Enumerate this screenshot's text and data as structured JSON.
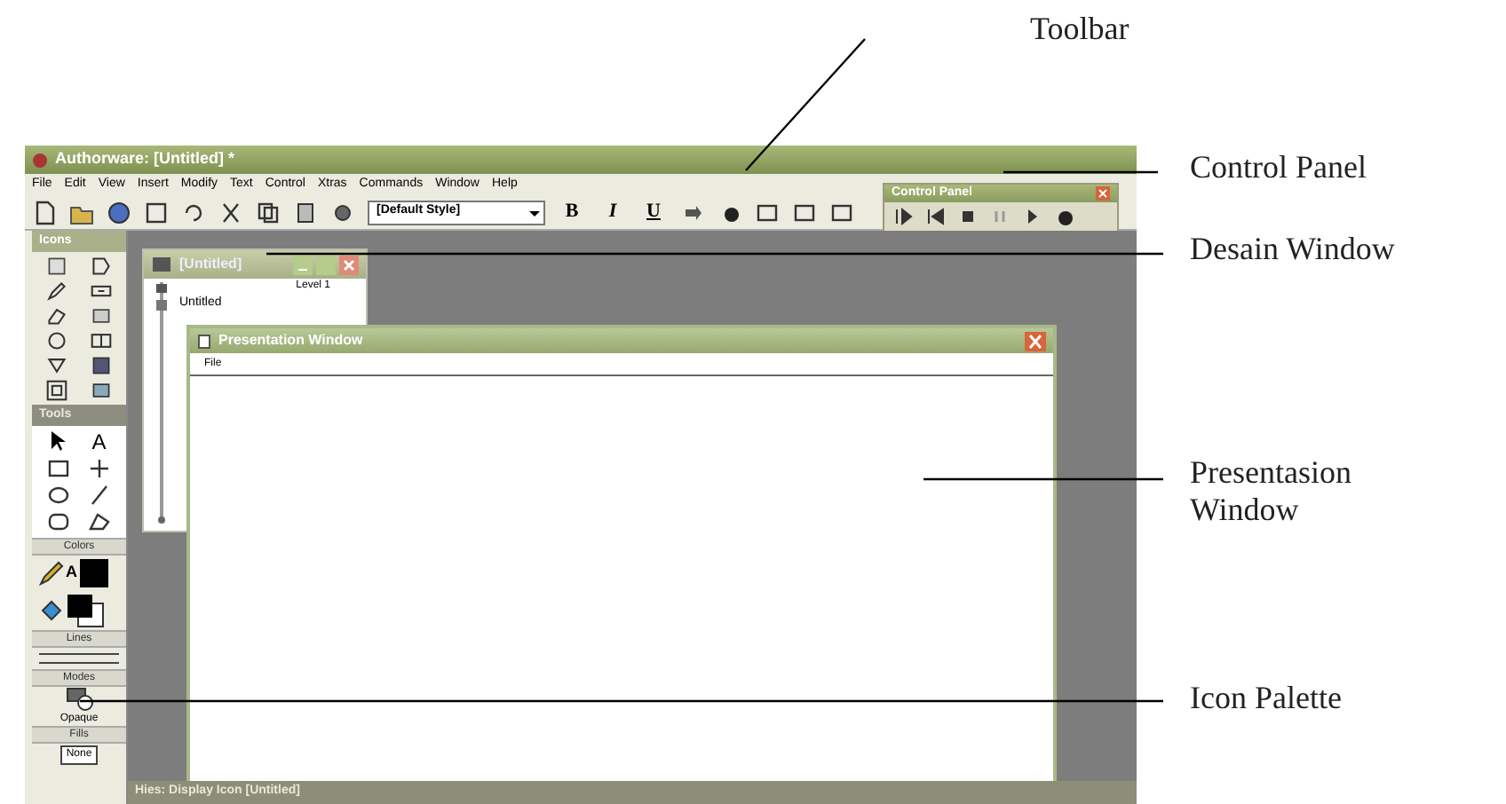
{
  "window": {
    "title": "Authorware: [Untitled] *"
  },
  "menu": [
    "File",
    "Edit",
    "View",
    "Insert",
    "Modify",
    "Text",
    "Control",
    "Xtras",
    "Commands",
    "Window",
    "Help"
  ],
  "toolbar": {
    "style_dropdown": "[Default Style]",
    "format_buttons": [
      "B",
      "I",
      "U"
    ]
  },
  "control_panel": {
    "title": "Control Panel"
  },
  "palette": {
    "icons_title": "Icons",
    "tools_title": "Tools",
    "text_tool": "A",
    "colors_title": "Colors",
    "colors_text": "A",
    "lines_title": "Lines",
    "modes_title": "Modes",
    "mode": "Opaque",
    "fills_title": "Fills",
    "fill": "None"
  },
  "design_window": {
    "title": "[Untitled]",
    "level": "Level 1",
    "items": [
      "Untitled"
    ]
  },
  "presentation_window": {
    "title": "Presentation Window",
    "menu": [
      "File"
    ]
  },
  "status_bar": "Hies: Display Icon [Untitled]",
  "annotations": [
    "Toolbar",
    "Control Panel",
    "Desain Window",
    "Presentasion Window",
    "Icon Palette"
  ]
}
